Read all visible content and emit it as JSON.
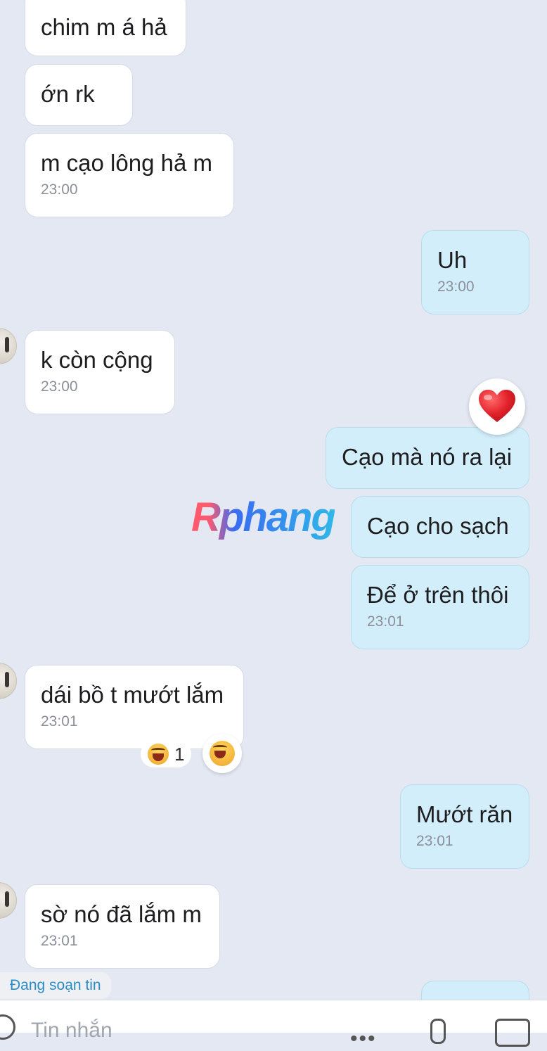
{
  "messages": [
    {
      "text": "chim m á hả",
      "time": ""
    },
    {
      "text": "ớn rk",
      "time": ""
    },
    {
      "text": "m cạo lông hả m",
      "time": "23:00"
    },
    {
      "text": "Uh",
      "time": "23:00"
    },
    {
      "text": "k còn cộng",
      "time": "23:00"
    },
    {
      "text": "Cạo mà nó ra lại",
      "time": ""
    },
    {
      "text": "Cạo cho sạch",
      "time": ""
    },
    {
      "text": "Để ở trên thôi",
      "time": "23:01"
    },
    {
      "text": "dái bồ t mướt lắm",
      "time": "23:01"
    },
    {
      "text": "Mướt răn",
      "time": "23:01"
    },
    {
      "text": "sờ nó đã lắm m",
      "time": "23:01"
    }
  ],
  "reactions": {
    "heart_icon": "red-heart",
    "laugh_icon": "laughing-face",
    "laugh_count": "1"
  },
  "watermark": "Rphang",
  "typing_indicator": "Đang soạn tin",
  "composer": {
    "placeholder": "Tin nhắn"
  },
  "colors": {
    "background": "#e3e8f3",
    "incoming_bubble": "#ffffff",
    "outgoing_bubble": "#d3eefb"
  }
}
